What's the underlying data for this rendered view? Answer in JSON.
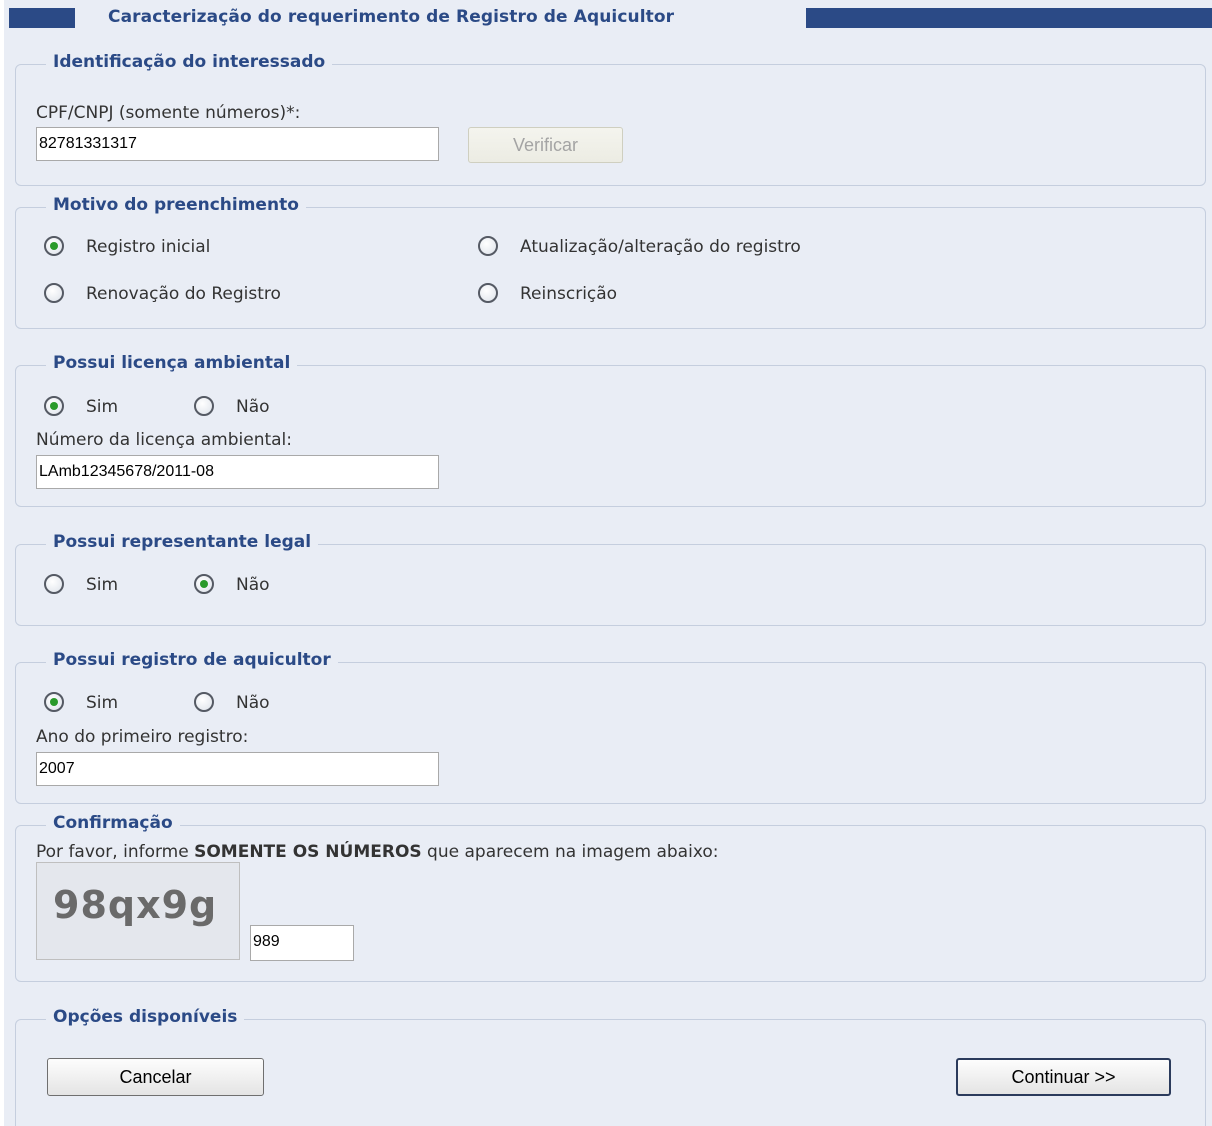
{
  "page": {
    "title": "Caracterização do requerimento de Registro de Aquicultor"
  },
  "identificacao": {
    "legend": "Identificação do interessado",
    "cpf_label": "CPF/CNPJ (somente números)*:",
    "cpf_value": "82781331317",
    "verificar_label": "Verificar"
  },
  "motivo": {
    "legend": "Motivo do preenchimento",
    "options": [
      {
        "label": "Registro inicial",
        "checked": true
      },
      {
        "label": "Atualização/alteração do registro",
        "checked": false
      },
      {
        "label": "Renovação do Registro",
        "checked": false
      },
      {
        "label": "Reinscrição",
        "checked": false
      }
    ]
  },
  "licenca": {
    "legend": "Possui licença ambiental",
    "options": [
      {
        "label": "Sim",
        "checked": true
      },
      {
        "label": "Não",
        "checked": false
      }
    ],
    "numero_label": "Número da licença ambiental:",
    "numero_value": "LAmb12345678/2011-08"
  },
  "representante": {
    "legend": "Possui representante legal",
    "options": [
      {
        "label": "Sim",
        "checked": false
      },
      {
        "label": "Não",
        "checked": true
      }
    ]
  },
  "registro": {
    "legend": "Possui registro de aquicultor",
    "options": [
      {
        "label": "Sim",
        "checked": true
      },
      {
        "label": "Não",
        "checked": false
      }
    ],
    "ano_label": "Ano do primeiro registro:",
    "ano_value": "2007"
  },
  "confirmacao": {
    "legend": "Confirmação",
    "instruction_prefix": "Por favor, informe ",
    "instruction_bold": "SOMENTE OS NÚMEROS",
    "instruction_suffix": " que aparecem na imagem abaixo:",
    "captcha_text": "98qx9g",
    "captcha_value": "989"
  },
  "opcoes": {
    "legend": "Opções disponíveis",
    "cancel_label": "Cancelar",
    "continue_label": "Continuar >>"
  },
  "colors": {
    "accent": "#2b4a86",
    "panel_bg": "#e9edf5",
    "radio_checked": "#2a9a2a"
  }
}
